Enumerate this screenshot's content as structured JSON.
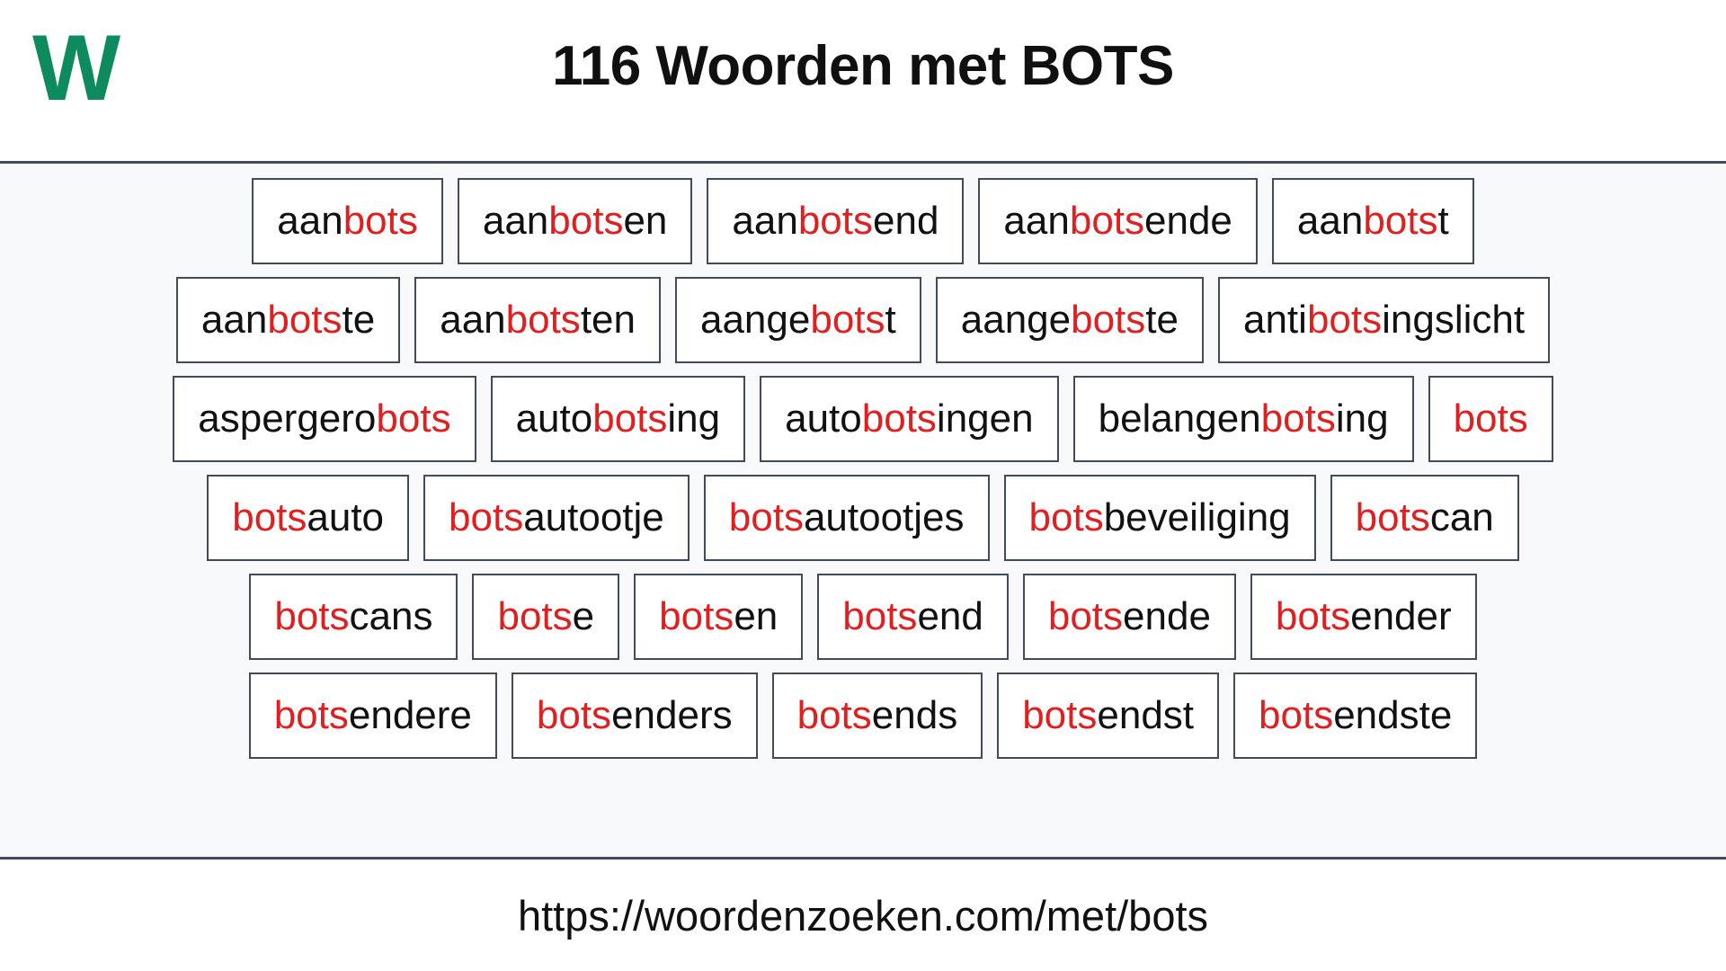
{
  "header": {
    "logo_text": "W",
    "logo_color": "#0e8a5f",
    "title": "116 Woorden met BOTS",
    "title_color": "#101010"
  },
  "theme": {
    "highlight_color": "#e02020",
    "text_color": "#111111",
    "border_color": "#424b57",
    "panel_background": "#f7f9fb",
    "page_background": "#ffffff"
  },
  "main": {
    "highlight_term": "bots",
    "rows": [
      {
        "words": [
          {
            "full": "aanbots",
            "pre": "aan",
            "hl": "bots",
            "post": ""
          },
          {
            "full": "aanbotsen",
            "pre": "aan",
            "hl": "bots",
            "post": "en"
          },
          {
            "full": "aanbotsend",
            "pre": "aan",
            "hl": "bots",
            "post": "end"
          },
          {
            "full": "aanbotsende",
            "pre": "aan",
            "hl": "bots",
            "post": "ende"
          },
          {
            "full": "aanbotst",
            "pre": "aan",
            "hl": "bots",
            "post": "t"
          }
        ]
      },
      {
        "words": [
          {
            "full": "aanbotste",
            "pre": "aan",
            "hl": "bots",
            "post": "te"
          },
          {
            "full": "aanbotsten",
            "pre": "aan",
            "hl": "bots",
            "post": "ten"
          },
          {
            "full": "aangebotst",
            "pre": "aange",
            "hl": "bots",
            "post": "t"
          },
          {
            "full": "aangebotste",
            "pre": "aange",
            "hl": "bots",
            "post": "te"
          },
          {
            "full": "antibotsingslicht",
            "pre": "anti",
            "hl": "bots",
            "post": "ingslicht"
          }
        ]
      },
      {
        "words": [
          {
            "full": "aspergerobots",
            "pre": "aspergero",
            "hl": "bots",
            "post": ""
          },
          {
            "full": "autobotsing",
            "pre": "auto",
            "hl": "bots",
            "post": "ing"
          },
          {
            "full": "autobotsingen",
            "pre": "auto",
            "hl": "bots",
            "post": "ingen"
          },
          {
            "full": "belangenbotsing",
            "pre": "belangen",
            "hl": "bots",
            "post": "ing"
          },
          {
            "full": "bots",
            "pre": "",
            "hl": "bots",
            "post": ""
          }
        ]
      },
      {
        "words": [
          {
            "full": "botsauto",
            "pre": "",
            "hl": "bots",
            "post": "auto"
          },
          {
            "full": "botsautootje",
            "pre": "",
            "hl": "bots",
            "post": "autootje"
          },
          {
            "full": "botsautootjes",
            "pre": "",
            "hl": "bots",
            "post": "autootjes"
          },
          {
            "full": "botsbeveiliging",
            "pre": "",
            "hl": "bots",
            "post": "beveiliging"
          },
          {
            "full": "botscan",
            "pre": "",
            "hl": "bots",
            "post": "can"
          }
        ]
      },
      {
        "words": [
          {
            "full": "botscans",
            "pre": "",
            "hl": "bots",
            "post": "cans"
          },
          {
            "full": "botse",
            "pre": "",
            "hl": "bots",
            "post": "e"
          },
          {
            "full": "botsen",
            "pre": "",
            "hl": "bots",
            "post": "en"
          },
          {
            "full": "botsend",
            "pre": "",
            "hl": "bots",
            "post": "end"
          },
          {
            "full": "botsende",
            "pre": "",
            "hl": "bots",
            "post": "ende"
          },
          {
            "full": "botsender",
            "pre": "",
            "hl": "bots",
            "post": "ender"
          }
        ]
      },
      {
        "words": [
          {
            "full": "botsendere",
            "pre": "",
            "hl": "bots",
            "post": "endere"
          },
          {
            "full": "botsenders",
            "pre": "",
            "hl": "bots",
            "post": "enders"
          },
          {
            "full": "botsends",
            "pre": "",
            "hl": "bots",
            "post": "ends"
          },
          {
            "full": "botsendst",
            "pre": "",
            "hl": "bots",
            "post": "endst"
          },
          {
            "full": "botsendste",
            "pre": "",
            "hl": "bots",
            "post": "endste"
          }
        ]
      }
    ]
  },
  "footer": {
    "url": "https://woordenzoeken.com/met/bots"
  }
}
